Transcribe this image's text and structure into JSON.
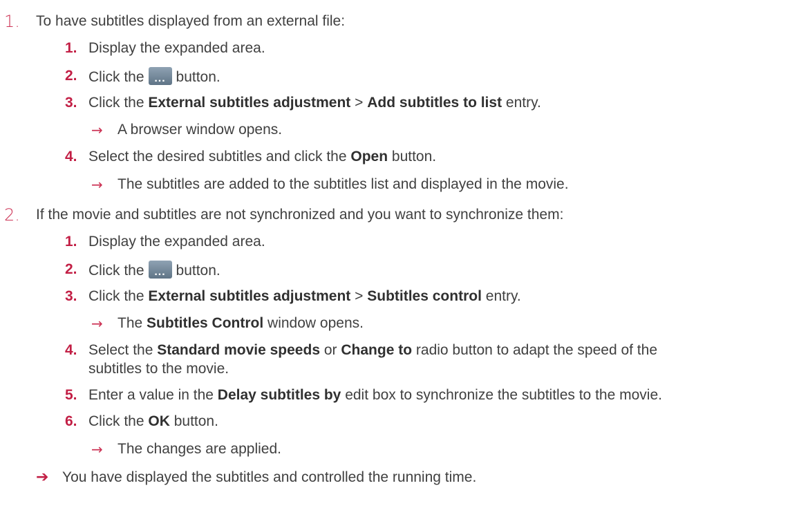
{
  "steps": [
    {
      "number": "1.",
      "intro": "To have subtitles displayed from an external file:",
      "substeps": [
        {
          "number": "1.",
          "text": "Display the expanded area."
        },
        {
          "number": "2.",
          "pre": "Click the",
          "post": "button.",
          "icon": "more-options-icon"
        },
        {
          "number": "3.",
          "pre": "Click the",
          "b1": "External subtitles adjustment",
          "sep": ">",
          "b2": "Add subtitles to list",
          "post": "entry."
        },
        {
          "result": "A browser window opens."
        },
        {
          "number": "4.",
          "pre": "Select the desired subtitles and click the",
          "b1": "Open",
          "post": "button."
        },
        {
          "result": "The subtitles are added to the subtitles list and displayed in the movie."
        }
      ]
    },
    {
      "number": "2.",
      "intro": "If the movie and subtitles are not synchronized and you want to synchronize them:",
      "substeps": [
        {
          "number": "1.",
          "text": "Display the expanded area."
        },
        {
          "number": "2.",
          "pre": "Click the",
          "post": "button.",
          "icon": "more-options-icon"
        },
        {
          "number": "3.",
          "pre": "Click the",
          "b1": "External subtitles adjustment",
          "sep": ">",
          "b2": "Subtitles control",
          "post": "entry."
        },
        {
          "result_pre": "The",
          "result_b": "Subtitles Control",
          "result_post": "window opens."
        },
        {
          "number": "4.",
          "pre": "Select the",
          "b1": "Standard movie speeds",
          "mid": "or",
          "b2": "Change to",
          "post": "radio button to adapt the speed of the",
          "cont": "subtitles to the movie."
        },
        {
          "number": "5.",
          "pre": "Enter a value in the",
          "b1": "Delay subtitles by",
          "post": "edit box to synchronize the subtitles to the movie."
        },
        {
          "number": "6.",
          "pre": "Click the",
          "b1": "OK",
          "post": "button."
        },
        {
          "result": "The changes are applied."
        }
      ]
    }
  ],
  "final_result": "You have displayed the subtitles and controlled the running time.",
  "glyphs": {
    "arrow": "→",
    "arrow_bold": "➔",
    "separator": ">",
    "dots": "..."
  },
  "colors": {
    "accent": "#c21f45",
    "text": "#404040",
    "button": "#6f8496"
  }
}
